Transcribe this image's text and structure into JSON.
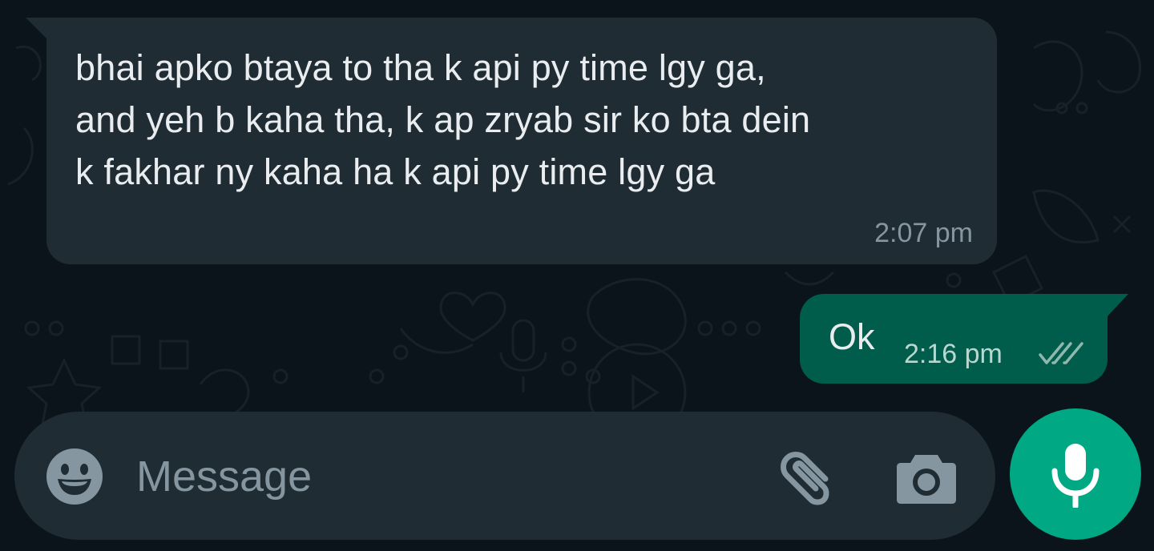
{
  "chat": {
    "incoming": {
      "lines": [
        "bhai apko btaya to tha k api py time lgy ga,",
        "and yeh b kaha tha, k ap zryab sir ko bta dein",
        "k fakhar ny kaha ha k api py time lgy ga"
      ],
      "time": "2:07 pm"
    },
    "outgoing": {
      "text": "Ok",
      "time": "2:16 pm",
      "status_icon": "double-check-icon"
    }
  },
  "composer": {
    "placeholder": "Message",
    "value": "",
    "emoji_icon": "emoji-icon",
    "attach_icon": "paperclip-icon",
    "camera_icon": "camera-icon",
    "mic_icon": "microphone-icon"
  },
  "colors": {
    "background": "#0b141a",
    "incoming_bubble": "#202c33",
    "outgoing_bubble": "#005c4b",
    "accent": "#00a884",
    "input_bar": "#1f2c34",
    "text_primary": "#e9edef",
    "text_secondary": "#8696a0"
  }
}
